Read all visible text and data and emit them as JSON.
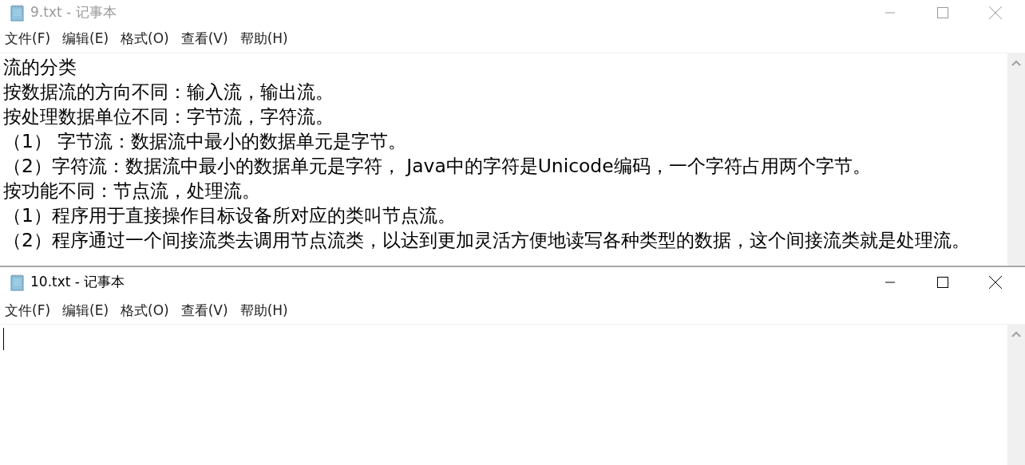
{
  "windows": [
    {
      "title": "9.txt - 记事本",
      "active": false,
      "menu": [
        "文件(F)",
        "编辑(E)",
        "格式(O)",
        "查看(V)",
        "帮助(H)"
      ],
      "caret": false,
      "lines": [
        "流的分类",
        "按数据流的方向不同：输入流，输出流。",
        "按处理数据单位不同：字节流，字符流。",
        "（1） 字节流：数据流中最小的数据单元是字节。",
        "（2）字符流：数据流中最小的数据单元是字符， Java中的字符是Unicode编码，一个字符占用两个字节。",
        "按功能不同：节点流，处理流。",
        "（1）程序用于直接操作目标设备所对应的类叫节点流。",
        "（2）程序通过一个间接流类去调用节点流类，以达到更加灵活方便地读写各种类型的数据，这个间接流类就是处理流。"
      ]
    },
    {
      "title": "10.txt - 记事本",
      "active": true,
      "menu": [
        "文件(F)",
        "编辑(E)",
        "格式(O)",
        "查看(V)",
        "帮助(H)"
      ],
      "caret": true
    }
  ]
}
